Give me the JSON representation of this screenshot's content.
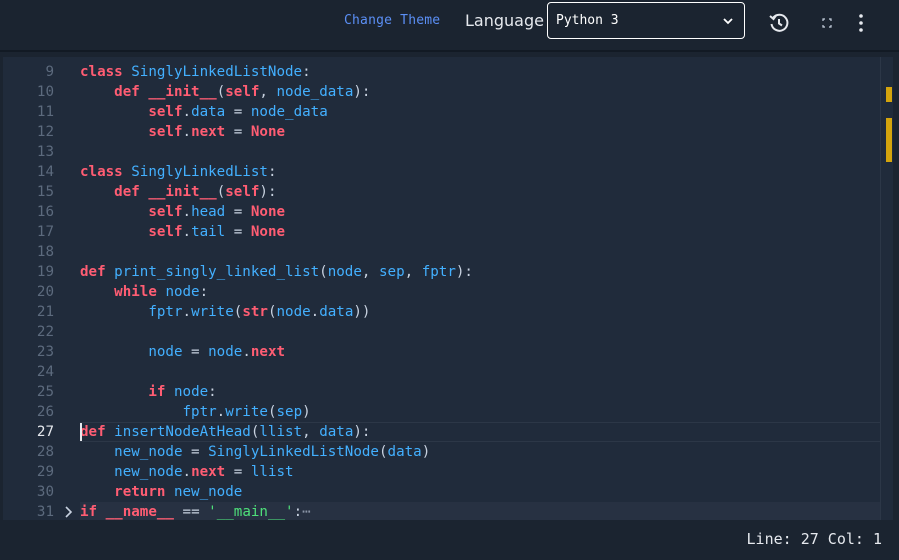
{
  "toolbar": {
    "change_theme_label": "Change Theme",
    "language_label": "Language",
    "language_value": "Python 3",
    "reset_icon": "restore-icon",
    "fullscreen_icon": "expand-icon",
    "menu_icon": "more-vertical-icon"
  },
  "editor": {
    "lines": [
      {
        "n": "9",
        "tokens": [
          [
            "kw",
            "class"
          ],
          [
            "plain",
            " "
          ],
          [
            "cls",
            "SinglyLinkedListNode"
          ],
          [
            "plain",
            ":"
          ]
        ]
      },
      {
        "n": "10",
        "tokens": [
          [
            "plain",
            "    "
          ],
          [
            "kw",
            "def"
          ],
          [
            "plain",
            " "
          ],
          [
            "dunder",
            "__init__"
          ],
          [
            "plain",
            "("
          ],
          [
            "self",
            "self"
          ],
          [
            "plain",
            ", "
          ],
          [
            "id",
            "node_data"
          ],
          [
            "plain",
            "):"
          ]
        ]
      },
      {
        "n": "11",
        "tokens": [
          [
            "plain",
            "        "
          ],
          [
            "self",
            "self"
          ],
          [
            "plain",
            "."
          ],
          [
            "id",
            "data"
          ],
          [
            "plain",
            " = "
          ],
          [
            "id",
            "node_data"
          ]
        ]
      },
      {
        "n": "12",
        "tokens": [
          [
            "plain",
            "        "
          ],
          [
            "self",
            "self"
          ],
          [
            "plain",
            "."
          ],
          [
            "kw",
            "next"
          ],
          [
            "plain",
            " = "
          ],
          [
            "kw",
            "None"
          ]
        ]
      },
      {
        "n": "13",
        "tokens": []
      },
      {
        "n": "14",
        "tokens": [
          [
            "kw",
            "class"
          ],
          [
            "plain",
            " "
          ],
          [
            "cls",
            "SinglyLinkedList"
          ],
          [
            "plain",
            ":"
          ]
        ]
      },
      {
        "n": "15",
        "tokens": [
          [
            "plain",
            "    "
          ],
          [
            "kw",
            "def"
          ],
          [
            "plain",
            " "
          ],
          [
            "dunder",
            "__init__"
          ],
          [
            "plain",
            "("
          ],
          [
            "self",
            "self"
          ],
          [
            "plain",
            "):"
          ]
        ]
      },
      {
        "n": "16",
        "tokens": [
          [
            "plain",
            "        "
          ],
          [
            "self",
            "self"
          ],
          [
            "plain",
            "."
          ],
          [
            "id",
            "head"
          ],
          [
            "plain",
            " = "
          ],
          [
            "kw",
            "None"
          ]
        ]
      },
      {
        "n": "17",
        "tokens": [
          [
            "plain",
            "        "
          ],
          [
            "self",
            "self"
          ],
          [
            "plain",
            "."
          ],
          [
            "id",
            "tail"
          ],
          [
            "plain",
            " = "
          ],
          [
            "kw",
            "None"
          ]
        ]
      },
      {
        "n": "18",
        "tokens": []
      },
      {
        "n": "19",
        "tokens": [
          [
            "kw",
            "def"
          ],
          [
            "plain",
            " "
          ],
          [
            "fn",
            "print_singly_linked_list"
          ],
          [
            "plain",
            "("
          ],
          [
            "id",
            "node"
          ],
          [
            "plain",
            ", "
          ],
          [
            "id",
            "sep"
          ],
          [
            "plain",
            ", "
          ],
          [
            "id",
            "fptr"
          ],
          [
            "plain",
            "):"
          ]
        ]
      },
      {
        "n": "20",
        "tokens": [
          [
            "plain",
            "    "
          ],
          [
            "kw",
            "while"
          ],
          [
            "plain",
            " "
          ],
          [
            "id",
            "node"
          ],
          [
            "plain",
            ":"
          ]
        ]
      },
      {
        "n": "21",
        "tokens": [
          [
            "plain",
            "        "
          ],
          [
            "id",
            "fptr"
          ],
          [
            "plain",
            "."
          ],
          [
            "id",
            "write"
          ],
          [
            "plain",
            "("
          ],
          [
            "kw",
            "str"
          ],
          [
            "plain",
            "("
          ],
          [
            "id",
            "node"
          ],
          [
            "plain",
            "."
          ],
          [
            "id",
            "data"
          ],
          [
            "plain",
            "))"
          ]
        ]
      },
      {
        "n": "22",
        "tokens": []
      },
      {
        "n": "23",
        "tokens": [
          [
            "plain",
            "        "
          ],
          [
            "id",
            "node"
          ],
          [
            "plain",
            " = "
          ],
          [
            "id",
            "node"
          ],
          [
            "plain",
            "."
          ],
          [
            "kw",
            "next"
          ]
        ]
      },
      {
        "n": "24",
        "tokens": []
      },
      {
        "n": "25",
        "tokens": [
          [
            "plain",
            "        "
          ],
          [
            "kw",
            "if"
          ],
          [
            "plain",
            " "
          ],
          [
            "id",
            "node"
          ],
          [
            "plain",
            ":"
          ]
        ]
      },
      {
        "n": "26",
        "tokens": [
          [
            "plain",
            "            "
          ],
          [
            "id",
            "fptr"
          ],
          [
            "plain",
            "."
          ],
          [
            "id",
            "write"
          ],
          [
            "plain",
            "("
          ],
          [
            "id",
            "sep"
          ],
          [
            "plain",
            ")"
          ]
        ]
      },
      {
        "n": "27",
        "tokens": [
          [
            "kw",
            "def"
          ],
          [
            "plain",
            " "
          ],
          [
            "fn",
            "insertNodeAtHead"
          ],
          [
            "plain",
            "("
          ],
          [
            "id",
            "llist"
          ],
          [
            "plain",
            ", "
          ],
          [
            "id",
            "data"
          ],
          [
            "plain",
            "):"
          ]
        ]
      },
      {
        "n": "28",
        "tokens": [
          [
            "plain",
            "    "
          ],
          [
            "id",
            "new_node"
          ],
          [
            "plain",
            " = "
          ],
          [
            "cls",
            "SinglyLinkedListNode"
          ],
          [
            "plain",
            "("
          ],
          [
            "id",
            "data"
          ],
          [
            "plain",
            ")"
          ]
        ]
      },
      {
        "n": "29",
        "tokens": [
          [
            "plain",
            "    "
          ],
          [
            "id",
            "new_node"
          ],
          [
            "plain",
            "."
          ],
          [
            "kw",
            "next"
          ],
          [
            "plain",
            " = "
          ],
          [
            "id",
            "llist"
          ]
        ]
      },
      {
        "n": "30",
        "tokens": [
          [
            "plain",
            "    "
          ],
          [
            "kw",
            "return"
          ],
          [
            "plain",
            " "
          ],
          [
            "id",
            "new_node"
          ]
        ]
      },
      {
        "n": "31",
        "tokens": [
          [
            "kw",
            "if"
          ],
          [
            "plain",
            " "
          ],
          [
            "dunder",
            "__name__"
          ],
          [
            "plain",
            " == "
          ],
          [
            "str",
            "'__main__'"
          ],
          [
            "plain",
            ":"
          ],
          [
            "ell",
            "⋯"
          ]
        ]
      }
    ],
    "current_line": "27",
    "folded_line": "31"
  },
  "status": {
    "position_text": "Line: 27 Col: 1"
  }
}
